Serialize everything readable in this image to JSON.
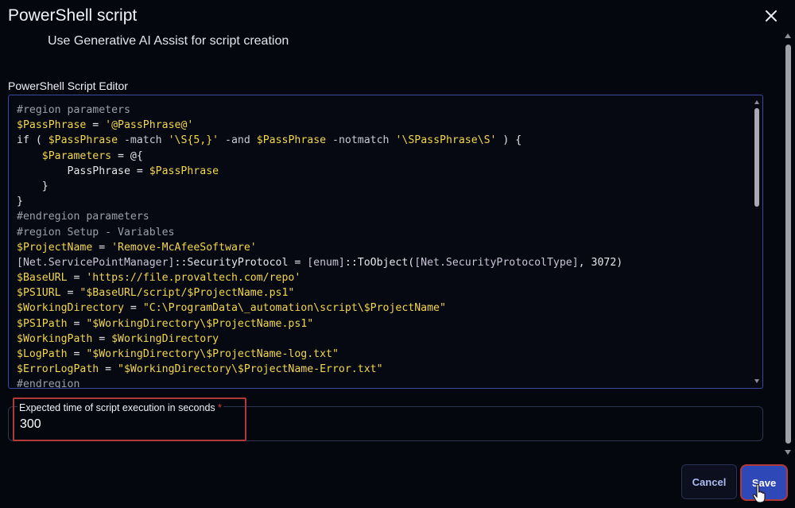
{
  "dialog": {
    "title": "PowerShell script",
    "close_icon": "close-icon"
  },
  "ai_toggle": {
    "label": "Use Generative AI Assist for script creation"
  },
  "editor": {
    "label": "PowerShell Script Editor",
    "lines": [
      "#region parameters",
      "$PassPhrase = '@PassPhrase@'",
      "if ( $PassPhrase -match '\\S{5,}' -and $PassPhrase -notmatch '\\SPassPhrase\\S' ) {",
      "    $Parameters = @{",
      "        PassPhrase = $PassPhrase",
      "    }",
      "}",
      "#endregion parameters",
      "#region Setup - Variables",
      "$ProjectName = 'Remove-McAfeeSoftware'",
      "[Net.ServicePointManager]::SecurityProtocol = [enum]::ToObject([Net.SecurityProtocolType], 3072)",
      "$BaseURL = 'https://file.provaltech.com/repo'",
      "$PS1URL = \"$BaseURL/script/$ProjectName.ps1\"",
      "$WorkingDirectory = \"C:\\ProgramData\\_automation\\script\\$ProjectName\"",
      "$PS1Path = \"$WorkingDirectory\\$ProjectName.ps1\"",
      "$WorkingPath = $WorkingDirectory",
      "$LogPath = \"$WorkingDirectory\\$ProjectName-log.txt\"",
      "$ErrorLogPath = \"$WorkingDirectory\\$ProjectName-Error.txt\"",
      "#endregion"
    ]
  },
  "execution_time": {
    "label": "Expected time of script execution in seconds",
    "required_mark": "*",
    "value": "300"
  },
  "buttons": {
    "cancel": "Cancel",
    "save": "Save"
  },
  "colors": {
    "background": "#05070f",
    "accent": "#2e48b7",
    "highlight": "#b03a3a",
    "code_variable": "#f2d64b",
    "code_comment": "#9aa0ab"
  }
}
